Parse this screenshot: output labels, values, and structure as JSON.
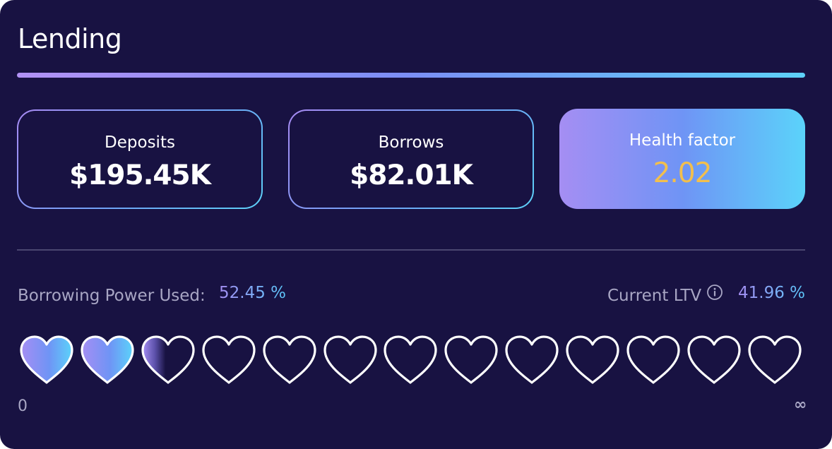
{
  "header": {
    "title": "Lending"
  },
  "stats": {
    "deposits": {
      "label": "Deposits",
      "value": "$195.45K"
    },
    "borrows": {
      "label": "Borrows",
      "value": "$82.01K"
    },
    "health": {
      "label": "Health factor",
      "value": "2.02"
    }
  },
  "borrowing": {
    "label": "Borrowing Power Used:",
    "value": "52.45 %",
    "ltv_label": "Current LTV",
    "ltv_value": "41.96 %",
    "info_icon": "info-circle-icon"
  },
  "meter": {
    "total_hearts": 13,
    "filled_hearts": 2.45,
    "min_label": "0",
    "max_label": "∞",
    "icon": "heart-icon"
  },
  "colors": {
    "background": "#181242",
    "accent_start": "#a58ef3",
    "accent_mid": "#6f94f5",
    "accent_end": "#5bd3fa",
    "health_value": "#f2bf4d",
    "muted_text": "#a8a6c4"
  }
}
